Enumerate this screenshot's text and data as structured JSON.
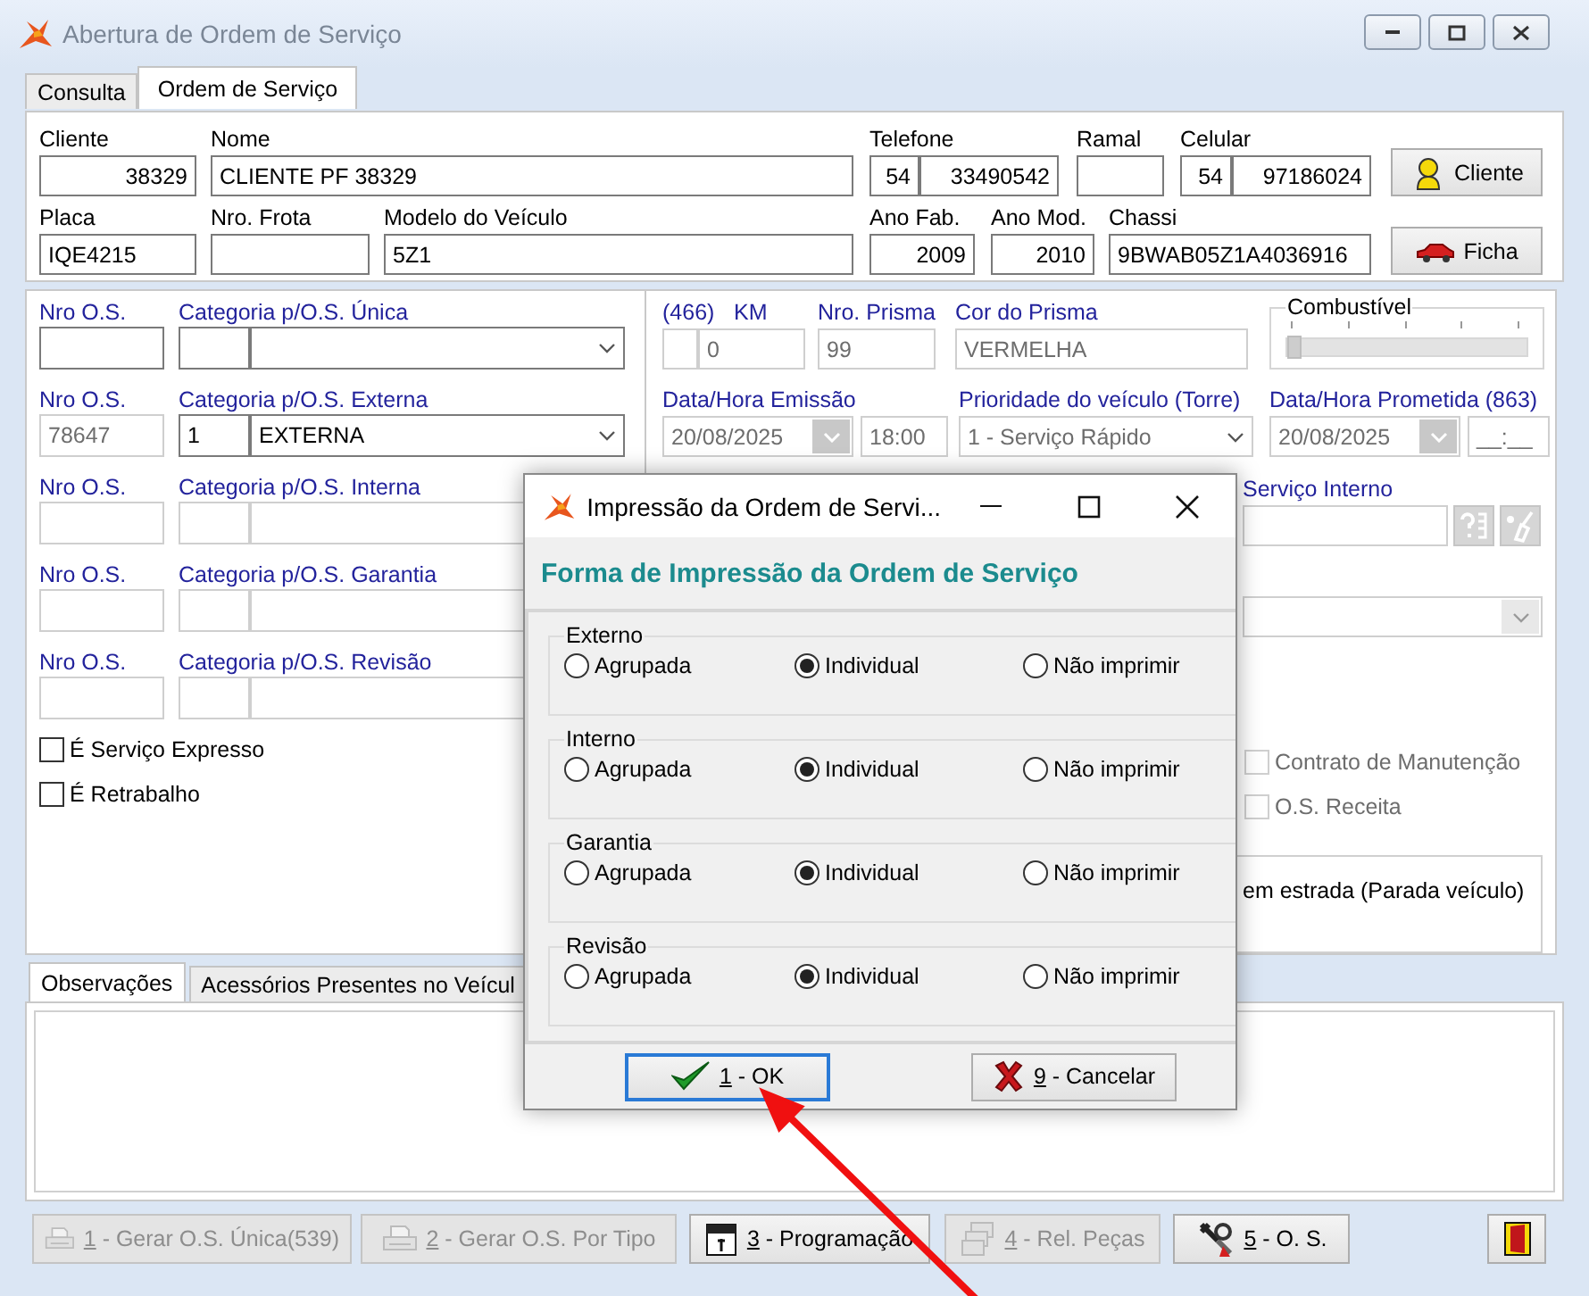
{
  "window": {
    "title": "Abertura de Ordem de Serviço"
  },
  "tabs": [
    {
      "label": "Consulta",
      "selected": false
    },
    {
      "label": "Ordem de Serviço",
      "selected": true
    }
  ],
  "customer": {
    "fields": [
      {
        "kind": "field",
        "label": "Cliente",
        "values": [
          "38329"
        ]
      },
      {
        "kind": "field",
        "label": "Nome",
        "values": [
          "CLIENTE PF 38329"
        ]
      },
      {
        "kind": "field",
        "label": "Telefone",
        "values": [
          "54",
          "33490542"
        ]
      },
      {
        "kind": "field",
        "label": "Ramal"
      },
      {
        "kind": "field",
        "label": "Celular",
        "values": [
          "54",
          "97186024"
        ]
      },
      {
        "kind": "client",
        "label": "Cliente"
      },
      {
        "kind": "field",
        "label": "Placa",
        "values": [
          "IQE4215"
        ]
      },
      {
        "kind": "field",
        "label": "Nro. Frota"
      },
      {
        "kind": "field",
        "label": "Modelo do Veículo",
        "values": [
          "5Z1"
        ]
      },
      {
        "kind": "field",
        "label": "Ano Fab.",
        "values": [
          "2009"
        ]
      },
      {
        "kind": "field",
        "label": "Ano Mod.",
        "values": [
          "2010"
        ]
      },
      {
        "kind": "field",
        "label": "Chassi",
        "values": [
          "9BWAB05Z1A4036916"
        ]
      },
      {
        "kind": "vehicle",
        "label": "Ficha"
      }
    ]
  },
  "order_types": [
    {
      "number_label": "Nro O.S.",
      "category_label": "Categoria p/O.S. Única",
      "number_disabled": false,
      "disabled": false
    },
    {
      "number_label": "Nro O.S.",
      "number": "78647",
      "category_label": "Categoria p/O.S. Externa",
      "code": "1",
      "category": "EXTERNA",
      "number_disabled": true,
      "disabled": false
    },
    {
      "number_label": "Nro O.S.",
      "category_label": "Categoria p/O.S. Interna",
      "number_disabled": true,
      "disabled": true
    },
    {
      "number_label": "Nro O.S.",
      "category_label": "Categoria p/O.S. Garantia",
      "number_disabled": true,
      "disabled": true
    },
    {
      "number_label": "Nro O.S.",
      "category_label": "Categoria p/O.S. Revisão",
      "number_disabled": true,
      "disabled": true
    }
  ],
  "flags": [
    {
      "label": "É Serviço Expresso",
      "checked": false
    },
    {
      "label": "É Retrabalho",
      "checked": false
    }
  ],
  "vehicle_status": {
    "km": {
      "prefix": "(466)",
      "label": "KM",
      "value": "0"
    },
    "prism_number": {
      "label": "Nro. Prisma",
      "value": "99"
    },
    "prism_color": {
      "label": "Cor do Prisma",
      "value": "VERMELHA"
    },
    "fuel": {
      "label": "Combustível",
      "level": 0
    },
    "issued": {
      "label": "Data/Hora Emissão",
      "date": "20/08/2025",
      "time": "18:00"
    },
    "priority": {
      "label": "Prioridade do veículo (Torre)",
      "value": "1 - Serviço Rápido"
    },
    "promised": {
      "label": "Data/Hora Prometida (863)",
      "date": "20/08/2025",
      "time": "__:__"
    },
    "internal_service": {
      "label": "Serviço Interno"
    },
    "options": [
      {
        "label": "Contrato de Manutenção",
        "checked": false,
        "disabled": true
      },
      {
        "label": "O.S. Receita",
        "checked": false,
        "disabled": true
      }
    ],
    "stop_note": "em estrada (Parada veículo)"
  },
  "detail_tabs": [
    {
      "label": "Observações",
      "selected": true
    },
    {
      "label": "Acessórios Presentes no Veícul",
      "selected": false
    }
  ],
  "actions": [
    {
      "kind": "printer",
      "key": "1",
      "label": "- Gerar O.S. Única(539)",
      "disabled": true
    },
    {
      "kind": "printer",
      "key": "2",
      "label": "- Gerar O.S. Por Tipo",
      "disabled": true
    },
    {
      "kind": "calendar",
      "key": "3",
      "label": "- Programação",
      "disabled": false
    },
    {
      "kind": "printers",
      "key": "4",
      "label": "- Rel. Peças",
      "disabled": true
    },
    {
      "kind": "tools",
      "key": "5",
      "label": "- O. S.",
      "disabled": false
    },
    {
      "kind": "exit",
      "disabled": false
    }
  ],
  "dialog": {
    "title": "Impressão da Ordem de Servi...",
    "heading": "Forma de Impressão da Ordem de Serviço",
    "groups": [
      {
        "label": "Externo",
        "options": [
          {
            "label": "Agrupada",
            "selected": false
          },
          {
            "label": "Individual",
            "selected": true
          },
          {
            "label": "Não imprimir",
            "selected": false
          }
        ]
      },
      {
        "label": "Interno",
        "options": [
          {
            "label": "Agrupada",
            "selected": false
          },
          {
            "label": "Individual",
            "selected": true
          },
          {
            "label": "Não imprimir",
            "selected": false
          }
        ]
      },
      {
        "label": "Garantia",
        "options": [
          {
            "label": "Agrupada",
            "selected": false
          },
          {
            "label": "Individual",
            "selected": true
          },
          {
            "label": "Não imprimir",
            "selected": false
          }
        ]
      },
      {
        "label": "Revisão",
        "options": [
          {
            "label": "Agrupada",
            "selected": false
          },
          {
            "label": "Individual",
            "selected": true
          },
          {
            "label": "Não imprimir",
            "selected": false
          }
        ]
      }
    ],
    "buttons": [
      {
        "kind": "ok",
        "key": "1",
        "label": "- OK",
        "focused": true
      },
      {
        "kind": "cancel",
        "key": "9",
        "label": "- Cancelar",
        "focused": false
      }
    ]
  }
}
